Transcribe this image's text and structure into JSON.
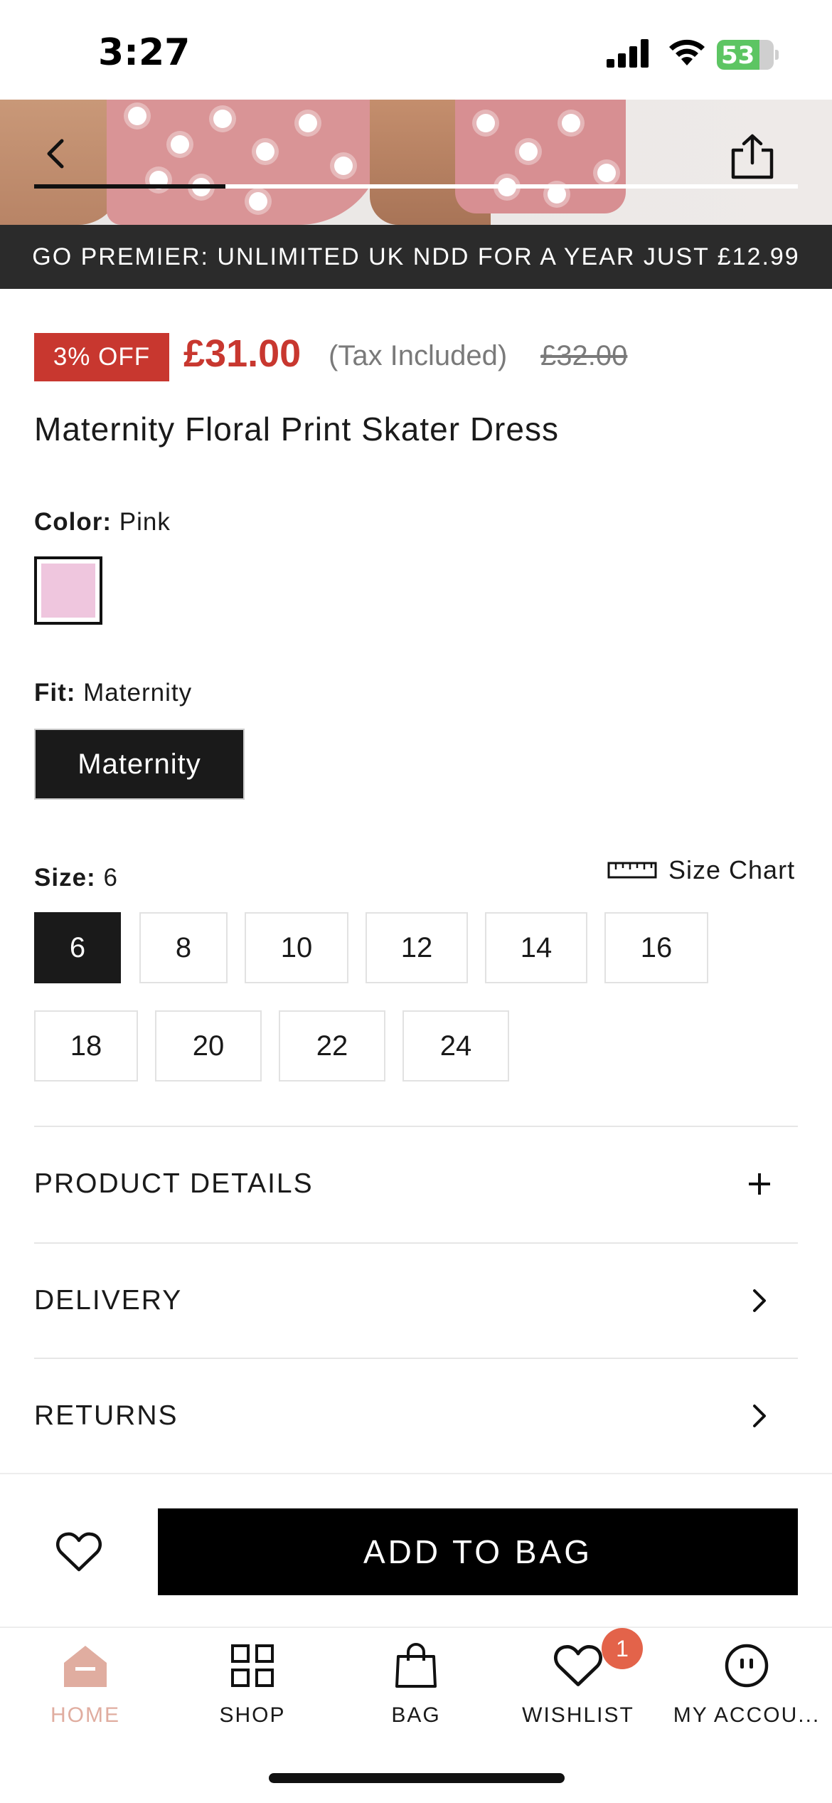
{
  "status_bar": {
    "time": "3:27",
    "battery": "53"
  },
  "promo_banner": {
    "text": "GO PREMIER: UNLIMITED UK NDD FOR A YEAR JUST £12.99"
  },
  "gallery": {
    "progress": 0.25
  },
  "price": {
    "discount_badge": "3% OFF",
    "current": "£31.00",
    "tax_note": "(Tax Included)",
    "original": "£32.00"
  },
  "product": {
    "title": "Maternity Floral Print Skater Dress"
  },
  "color": {
    "label": "Color:",
    "value": "Pink",
    "swatch_hex": "#efc6de"
  },
  "fit": {
    "label": "Fit:",
    "value": "Maternity",
    "option": "Maternity"
  },
  "size": {
    "label": "Size:",
    "value": "6",
    "chart_label": "Size Chart",
    "options": [
      "6",
      "8",
      "10",
      "12",
      "14",
      "16",
      "18",
      "20",
      "22",
      "24"
    ],
    "selected": "6"
  },
  "accordion": {
    "product_details": "PRODUCT DETAILS",
    "delivery": "DELIVERY",
    "returns": "RETURNS"
  },
  "actions": {
    "add_to_bag": "ADD TO BAG"
  },
  "tab_bar": {
    "home": "HOME",
    "shop": "SHOP",
    "bag": "BAG",
    "wishlist": "WISHLIST",
    "account": "MY ACCOU...",
    "wishlist_count": "1",
    "active_color": "#e0ada0"
  },
  "colors": {
    "sale_red": "#c8372f",
    "banner_bg": "#2b2b2b",
    "badge_orange": "#e3634a"
  }
}
